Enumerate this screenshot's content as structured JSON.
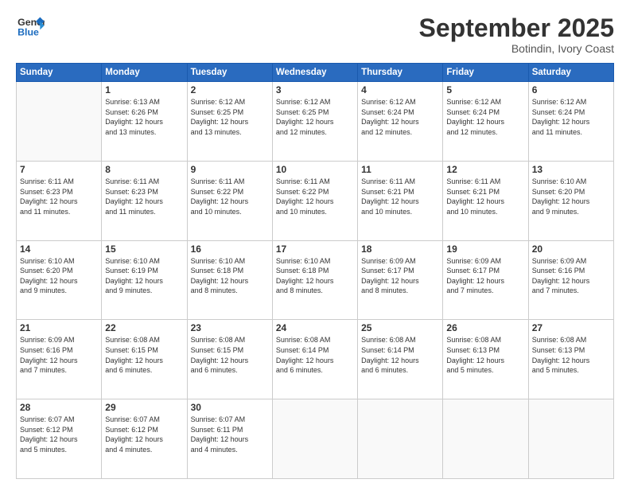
{
  "logo": {
    "line1": "General",
    "line2": "Blue"
  },
  "title": "September 2025",
  "location": "Botindin, Ivory Coast",
  "weekdays": [
    "Sunday",
    "Monday",
    "Tuesday",
    "Wednesday",
    "Thursday",
    "Friday",
    "Saturday"
  ],
  "days": [
    {
      "num": "",
      "info": ""
    },
    {
      "num": "1",
      "info": "Sunrise: 6:13 AM\nSunset: 6:26 PM\nDaylight: 12 hours\nand 13 minutes."
    },
    {
      "num": "2",
      "info": "Sunrise: 6:12 AM\nSunset: 6:25 PM\nDaylight: 12 hours\nand 13 minutes."
    },
    {
      "num": "3",
      "info": "Sunrise: 6:12 AM\nSunset: 6:25 PM\nDaylight: 12 hours\nand 12 minutes."
    },
    {
      "num": "4",
      "info": "Sunrise: 6:12 AM\nSunset: 6:24 PM\nDaylight: 12 hours\nand 12 minutes."
    },
    {
      "num": "5",
      "info": "Sunrise: 6:12 AM\nSunset: 6:24 PM\nDaylight: 12 hours\nand 12 minutes."
    },
    {
      "num": "6",
      "info": "Sunrise: 6:12 AM\nSunset: 6:24 PM\nDaylight: 12 hours\nand 11 minutes."
    },
    {
      "num": "7",
      "info": "Sunrise: 6:11 AM\nSunset: 6:23 PM\nDaylight: 12 hours\nand 11 minutes."
    },
    {
      "num": "8",
      "info": "Sunrise: 6:11 AM\nSunset: 6:23 PM\nDaylight: 12 hours\nand 11 minutes."
    },
    {
      "num": "9",
      "info": "Sunrise: 6:11 AM\nSunset: 6:22 PM\nDaylight: 12 hours\nand 10 minutes."
    },
    {
      "num": "10",
      "info": "Sunrise: 6:11 AM\nSunset: 6:22 PM\nDaylight: 12 hours\nand 10 minutes."
    },
    {
      "num": "11",
      "info": "Sunrise: 6:11 AM\nSunset: 6:21 PM\nDaylight: 12 hours\nand 10 minutes."
    },
    {
      "num": "12",
      "info": "Sunrise: 6:11 AM\nSunset: 6:21 PM\nDaylight: 12 hours\nand 10 minutes."
    },
    {
      "num": "13",
      "info": "Sunrise: 6:10 AM\nSunset: 6:20 PM\nDaylight: 12 hours\nand 9 minutes."
    },
    {
      "num": "14",
      "info": "Sunrise: 6:10 AM\nSunset: 6:20 PM\nDaylight: 12 hours\nand 9 minutes."
    },
    {
      "num": "15",
      "info": "Sunrise: 6:10 AM\nSunset: 6:19 PM\nDaylight: 12 hours\nand 9 minutes."
    },
    {
      "num": "16",
      "info": "Sunrise: 6:10 AM\nSunset: 6:18 PM\nDaylight: 12 hours\nand 8 minutes."
    },
    {
      "num": "17",
      "info": "Sunrise: 6:10 AM\nSunset: 6:18 PM\nDaylight: 12 hours\nand 8 minutes."
    },
    {
      "num": "18",
      "info": "Sunrise: 6:09 AM\nSunset: 6:17 PM\nDaylight: 12 hours\nand 8 minutes."
    },
    {
      "num": "19",
      "info": "Sunrise: 6:09 AM\nSunset: 6:17 PM\nDaylight: 12 hours\nand 7 minutes."
    },
    {
      "num": "20",
      "info": "Sunrise: 6:09 AM\nSunset: 6:16 PM\nDaylight: 12 hours\nand 7 minutes."
    },
    {
      "num": "21",
      "info": "Sunrise: 6:09 AM\nSunset: 6:16 PM\nDaylight: 12 hours\nand 7 minutes."
    },
    {
      "num": "22",
      "info": "Sunrise: 6:08 AM\nSunset: 6:15 PM\nDaylight: 12 hours\nand 6 minutes."
    },
    {
      "num": "23",
      "info": "Sunrise: 6:08 AM\nSunset: 6:15 PM\nDaylight: 12 hours\nand 6 minutes."
    },
    {
      "num": "24",
      "info": "Sunrise: 6:08 AM\nSunset: 6:14 PM\nDaylight: 12 hours\nand 6 minutes."
    },
    {
      "num": "25",
      "info": "Sunrise: 6:08 AM\nSunset: 6:14 PM\nDaylight: 12 hours\nand 6 minutes."
    },
    {
      "num": "26",
      "info": "Sunrise: 6:08 AM\nSunset: 6:13 PM\nDaylight: 12 hours\nand 5 minutes."
    },
    {
      "num": "27",
      "info": "Sunrise: 6:08 AM\nSunset: 6:13 PM\nDaylight: 12 hours\nand 5 minutes."
    },
    {
      "num": "28",
      "info": "Sunrise: 6:07 AM\nSunset: 6:12 PM\nDaylight: 12 hours\nand 5 minutes."
    },
    {
      "num": "29",
      "info": "Sunrise: 6:07 AM\nSunset: 6:12 PM\nDaylight: 12 hours\nand 4 minutes."
    },
    {
      "num": "30",
      "info": "Sunrise: 6:07 AM\nSunset: 6:11 PM\nDaylight: 12 hours\nand 4 minutes."
    },
    {
      "num": "",
      "info": ""
    },
    {
      "num": "",
      "info": ""
    },
    {
      "num": "",
      "info": ""
    },
    {
      "num": "",
      "info": ""
    }
  ]
}
